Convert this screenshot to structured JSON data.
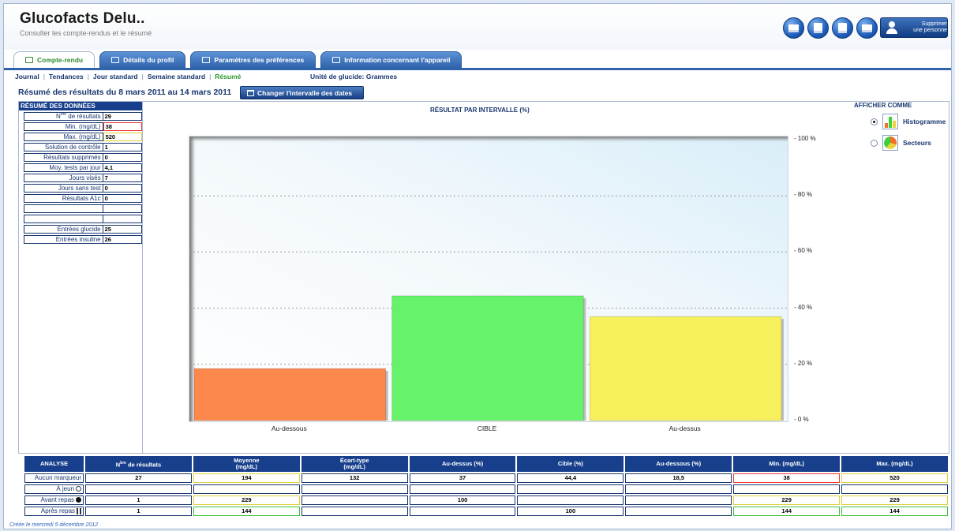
{
  "app": {
    "title": "Glucofacts Delu..",
    "subtitle": "Consulter les compte-rendus et le résumé",
    "delete_person_label_1": "Supprimer",
    "delete_person_label_2": "une personne"
  },
  "tabs": [
    {
      "label": "Compte-rendu",
      "active": true
    },
    {
      "label": "Détails du profil",
      "active": false
    },
    {
      "label": "Paramètres des préférences",
      "active": false
    },
    {
      "label": "Information concernant l'appareil",
      "active": false
    }
  ],
  "subnav": {
    "items": [
      "Journal",
      "Tendances",
      "Jour standard",
      "Semaine standard",
      "Résumé"
    ],
    "current": "Résumé",
    "unit": "Unité de glucide: Grammes"
  },
  "range": {
    "title": "Résumé des résultats du 8 mars 2011 au 14 mars 2011",
    "button": "Changer l'intervalle des dates"
  },
  "summary": {
    "title": "RÉSUMÉ DES DONNÉES",
    "rows": [
      {
        "label_pre": "N",
        "label_sup": "bre",
        "label": " de résultats",
        "value": "29",
        "style": ""
      },
      {
        "label": "Min. (mg/dL)",
        "value": "38",
        "style": "red"
      },
      {
        "label": "Max. (mg/dL)",
        "value": "520",
        "style": "yellow"
      },
      {
        "label": "Solution de contrôle",
        "value": "1",
        "style": ""
      },
      {
        "label": "Résultats supprimés",
        "value": "0",
        "style": ""
      },
      {
        "label": "Moy. tests par jour",
        "value": "4,1",
        "style": ""
      },
      {
        "label": "Jours visés",
        "value": "7",
        "style": ""
      },
      {
        "label": "Jours sans test",
        "value": "0",
        "style": ""
      },
      {
        "label": "Résultats A1c",
        "value": "0",
        "style": ""
      },
      {
        "label": "",
        "value": "",
        "style": ""
      },
      {
        "label": "",
        "value": "",
        "style": ""
      },
      {
        "label": "Entrées glucide",
        "value": "25",
        "style": ""
      },
      {
        "label": "Entrées insuline",
        "value": "26",
        "style": ""
      }
    ]
  },
  "display_as": {
    "title": "AFFICHER COMME",
    "options": [
      {
        "label": "Histogramme",
        "selected": true
      },
      {
        "label": "Secteurs",
        "selected": false
      }
    ]
  },
  "chart_data": {
    "type": "bar",
    "title": "RÉSULTAT PAR INTERVALLE (%)",
    "categories": [
      "Au-dessous",
      "CIBLE",
      "Au-dessus"
    ],
    "values": [
      18.5,
      44.4,
      37
    ],
    "colors": [
      "#fc884c",
      "#66f26b",
      "#f5f05c"
    ],
    "ylim": [
      0,
      100
    ],
    "yticks": [
      "0 %",
      "20 %",
      "40 %",
      "60 %",
      "80 %",
      "100 %"
    ],
    "grid": true
  },
  "analysis": {
    "headers": [
      "ANALYSE",
      "de résultats",
      "Moyenne",
      "Écart-type",
      "Au-dessus (%)",
      "Cible (%)",
      "Au-dessous (%)",
      "Min. (mg/dL)",
      "Max. (mg/dL)"
    ],
    "header_count_pre": "N",
    "header_count_sup": "bre",
    "header_unit": "(mg/dL)",
    "rows": [
      {
        "label": "Aucun marqueur",
        "cells": [
          "27",
          "194",
          "132",
          "37",
          "44,4",
          "18,5",
          "38",
          "520"
        ],
        "icon": ""
      },
      {
        "label": "À jeun",
        "cells": [
          "",
          "",
          "",
          "",
          "",
          "",
          "",
          ""
        ],
        "icon": "circle"
      },
      {
        "label": "Avant repas",
        "cells": [
          "1",
          "229",
          "",
          "100",
          "",
          "",
          "229",
          "229"
        ],
        "icon": "apple"
      },
      {
        "label": "Après repas",
        "cells": [
          "1",
          "144",
          "",
          "",
          "100",
          "",
          "144",
          "144"
        ],
        "icon": "apple-core"
      }
    ]
  },
  "footer": "Créée le mercredi 5 décembre 2012"
}
